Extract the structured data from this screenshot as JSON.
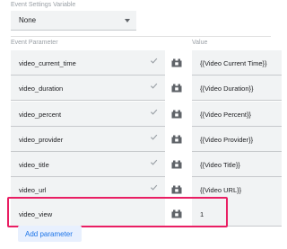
{
  "event_settings": {
    "label": "Event Settings Variable",
    "selected": "None",
    "dropdown_icon": "caret-down-icon"
  },
  "columns": {
    "parameter": "Event Parameter",
    "value": "Value"
  },
  "rows": [
    {
      "name": "video_current_time",
      "value": "{{Video Current Time}}",
      "validated": true
    },
    {
      "name": "video_duration",
      "value": "{{Video Duration}}",
      "validated": true
    },
    {
      "name": "video_percent",
      "value": "{{Video Percent}}",
      "validated": true
    },
    {
      "name": "video_provider",
      "value": "{{Video Provider}}",
      "validated": true
    },
    {
      "name": "video_title",
      "value": "{{Video Title}}",
      "validated": true
    },
    {
      "name": "video_url",
      "value": "{{Video URL}}",
      "validated": true
    },
    {
      "name": "video_view",
      "value": "1",
      "validated": false
    }
  ],
  "add_button": {
    "label": "Add parameter"
  },
  "icons": {
    "check": "check-icon",
    "variable": "variable-picker-icon"
  },
  "colors": {
    "accent": "#1a73e8",
    "highlight": "#e91e63",
    "field_bg": "#f1f3f4",
    "button_bg": "#e8f0fe"
  }
}
